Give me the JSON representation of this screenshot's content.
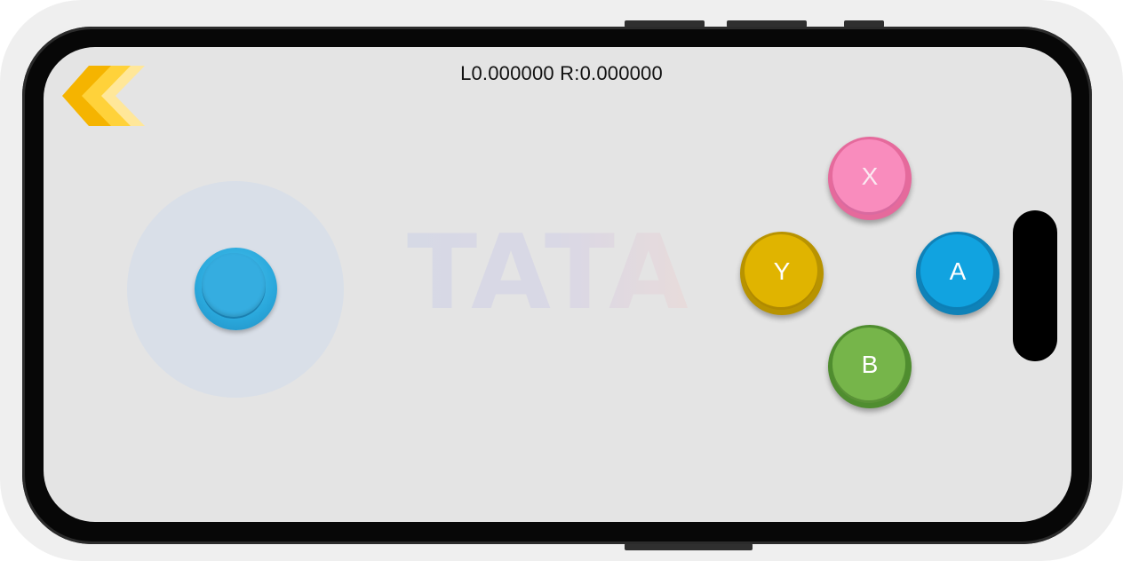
{
  "status": {
    "readout": "L0.000000 R:0.000000"
  },
  "watermark": {
    "text": "TATA"
  },
  "back_button": {
    "icon": "double-chevron-left-icon",
    "colors": [
      "#f5b400",
      "#ffd23a",
      "#ffe799"
    ]
  },
  "joystick": {
    "color": "#35ade0",
    "base_color": "#d9dfe8"
  },
  "face_buttons": {
    "x": {
      "label": "X",
      "color": "#f98cbd"
    },
    "y": {
      "label": "Y",
      "color": "#e0b400"
    },
    "a": {
      "label": "A",
      "color": "#11a3e0"
    },
    "b": {
      "label": "B",
      "color": "#76b54a"
    }
  }
}
